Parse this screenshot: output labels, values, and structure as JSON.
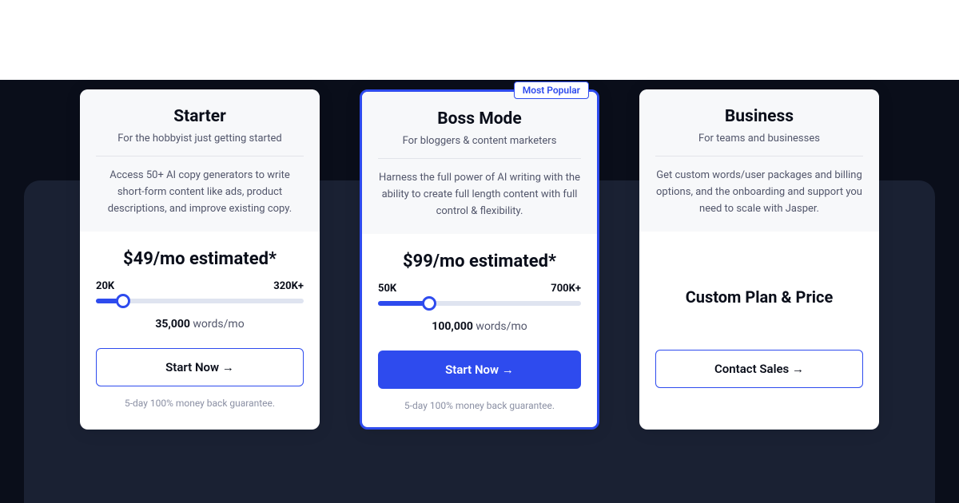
{
  "badge": "Most Popular",
  "plans": {
    "starter": {
      "title": "Starter",
      "tagline": "For the hobbyist just getting started",
      "desc": "Access 50+ AI copy generators to write short-form content like ads, product descriptions, and improve existing copy.",
      "price": "$49/mo estimated*",
      "min": "20K",
      "max": "320K+",
      "words_count": "35,000",
      "words_unit": "words/mo",
      "cta": "Start Now →",
      "guarantee": "5-day 100% money back guarantee."
    },
    "boss": {
      "title": "Boss Mode",
      "tagline": "For bloggers & content marketers",
      "desc": "Harness the full power of AI writing with the ability to create full length content with full control & flexibility.",
      "price": "$99/mo estimated*",
      "min": "50K",
      "max": "700K+",
      "words_count": "100,000",
      "words_unit": "words/mo",
      "cta": "Start Now →",
      "guarantee": "5-day 100% money back guarantee."
    },
    "business": {
      "title": "Business",
      "tagline": "For teams and businesses",
      "desc": "Get custom words/user packages and billing options, and the onboarding and support you need to scale with Jasper.",
      "custom": "Custom Plan & Price",
      "cta": "Contact Sales →"
    }
  }
}
